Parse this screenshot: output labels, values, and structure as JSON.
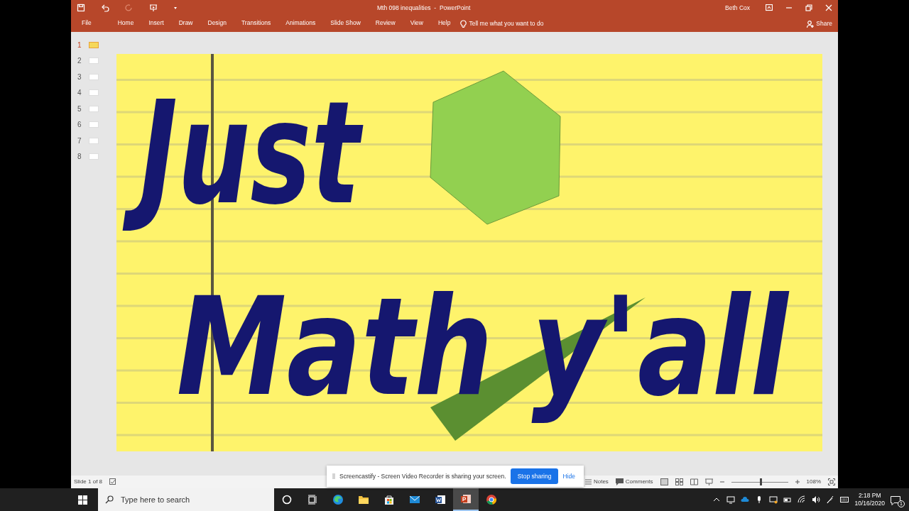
{
  "title_bar": {
    "title": "Mth 098 inequalities  -  PowerPoint",
    "user": "Beth Cox"
  },
  "ribbon_tabs": [
    {
      "label": "File",
      "selected": false
    },
    {
      "label": "Home",
      "selected": false
    },
    {
      "label": "Insert",
      "selected": false
    },
    {
      "label": "Draw",
      "selected": false
    },
    {
      "label": "Design",
      "selected": false
    },
    {
      "label": "Transitions",
      "selected": false
    },
    {
      "label": "Animations",
      "selected": false
    },
    {
      "label": "Slide Show",
      "selected": false
    },
    {
      "label": "Review",
      "selected": false
    },
    {
      "label": "View",
      "selected": false
    },
    {
      "label": "Help",
      "selected": false
    }
  ],
  "tell_me": {
    "placeholder": "Tell me what you want to do"
  },
  "share_button": "Share",
  "slides": [
    {
      "number": "1",
      "selected": true
    },
    {
      "number": "2",
      "selected": false
    },
    {
      "number": "3",
      "selected": false
    },
    {
      "number": "4",
      "selected": false
    },
    {
      "number": "5",
      "selected": false
    },
    {
      "number": "6",
      "selected": false
    },
    {
      "number": "7",
      "selected": false
    },
    {
      "number": "8",
      "selected": false
    }
  ],
  "slide": {
    "ink": [
      "Just",
      "Math y'all"
    ]
  },
  "status_bar": {
    "slide_counter": "Slide 1 of 8",
    "notes": "Notes",
    "comments": "Comments",
    "zoom": "108%",
    "zoom_level": {
      "level": 0.52
    }
  },
  "sharing_banner": {
    "message": "Screencastify - Screen Video Recorder is sharing your screen.",
    "stop_button": "Stop sharing",
    "hide_link": "Hide"
  },
  "taskbar": {
    "search": {
      "placeholder": "Type here to search"
    },
    "apps": [
      {
        "kind": "edge",
        "selected": false
      },
      {
        "kind": "folder",
        "selected": false
      },
      {
        "kind": "store",
        "selected": false
      },
      {
        "kind": "mail",
        "selected": false
      },
      {
        "kind": "word",
        "selected": false
      },
      {
        "kind": "powerpoint",
        "selected": true
      },
      {
        "kind": "chrome",
        "selected": false
      }
    ],
    "time": "2:18 PM",
    "date": "10/16/2020",
    "notifications": "1"
  }
}
